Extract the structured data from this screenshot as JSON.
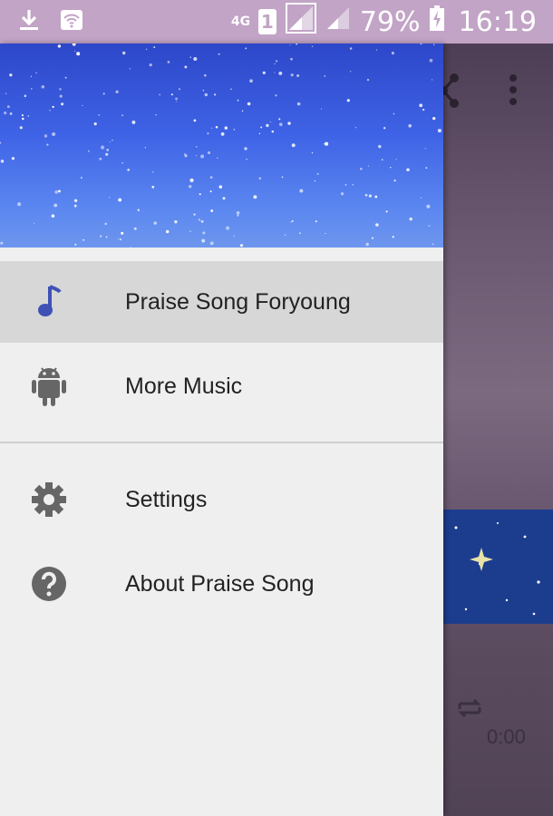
{
  "status_bar": {
    "network": "4G",
    "sim": "1",
    "battery": "79%",
    "time": "16:19"
  },
  "drawer": {
    "items": [
      {
        "label": "Praise Song Foryoung",
        "icon": "music-note-icon",
        "active": true
      },
      {
        "label": "More Music",
        "icon": "android-icon",
        "active": false
      },
      {
        "label": "Settings",
        "icon": "gear-icon",
        "active": false
      },
      {
        "label": "About Praise Song",
        "icon": "help-icon",
        "active": false
      }
    ]
  },
  "player": {
    "elapsed": "0:00"
  },
  "colors": {
    "status_bar": "#c2a4c6",
    "drawer_bg": "#efefef",
    "active_item_bg": "#d7d7d7",
    "accent": "#3f51b5"
  }
}
